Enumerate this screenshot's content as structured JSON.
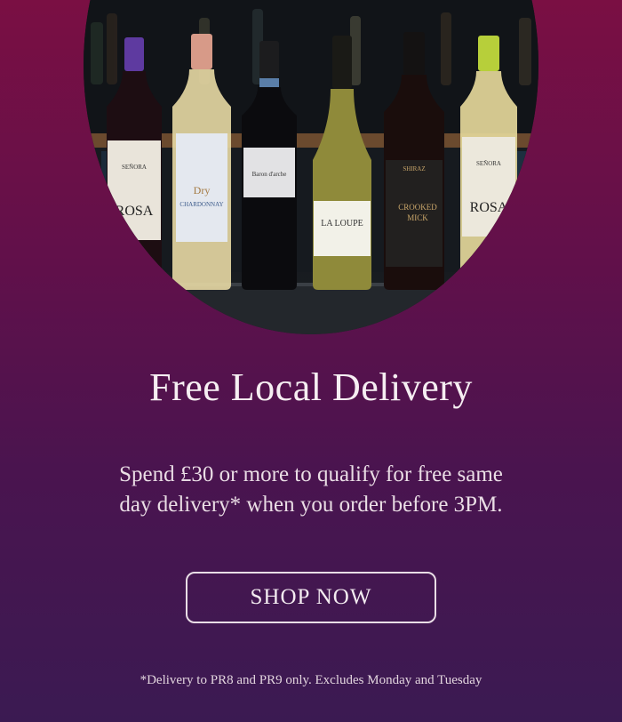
{
  "hero": {
    "bottles": [
      {
        "name": "senora-rosa-red-bottle",
        "label_lines": [
          "SEÑORA",
          "ROSA"
        ]
      },
      {
        "name": "dry-white-chardonnay-bottle",
        "label_lines": [
          "Dry",
          "CHARDONNAY"
        ]
      },
      {
        "name": "pinot-grigio-bottle",
        "label_lines": [
          "Baron d'arche"
        ]
      },
      {
        "name": "la-loupe-bottle",
        "label_lines": [
          "LA LOUPE"
        ]
      },
      {
        "name": "crooked-mick-shiraz-bottle",
        "label_lines": [
          "SHIRAZ",
          "CROOKED",
          "MICK"
        ]
      },
      {
        "name": "senora-rosa-white-bottle",
        "label_lines": [
          "SEÑORA",
          "ROSA"
        ]
      }
    ]
  },
  "headline": "Free Local Delivery",
  "body": {
    "line1": "Spend £30 or more to qualify for free same",
    "line2": "day delivery* when you order before 3PM."
  },
  "cta": {
    "label": "SHOP NOW"
  },
  "footnote": "*Delivery to PR8 and PR9 only. Excludes Monday and Tuesday",
  "colors": {
    "background_top": "#7a0f43",
    "background_bottom": "#3b1a52",
    "text": "#f6eef2",
    "button_border": "#e9dde6"
  }
}
